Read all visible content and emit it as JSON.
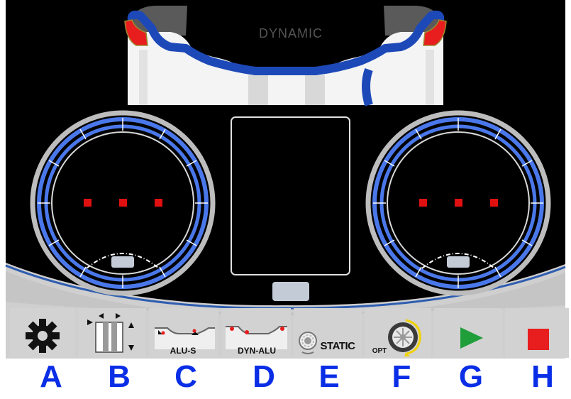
{
  "screen": {
    "mode_title": "DYNAMIC",
    "colors": {
      "panel": "#000000",
      "rim_blue": "#1d49b8",
      "ring_blue": "#4a78ea",
      "plane_marker": "#e01010",
      "weight_red": "#e81e1e",
      "tray_gray": "#c9c9c9",
      "button_gray": "#d2d2d2",
      "letter_blue": "#0a2ee6"
    }
  },
  "left_display": {
    "name": "left-plane-display",
    "readout": "",
    "dots": 3
  },
  "right_display": {
    "name": "right-plane-display",
    "readout": "",
    "dots": 3
  },
  "center_display": {
    "name": "center-value-display",
    "readout": ""
  },
  "function_bar": {
    "buttons": [
      {
        "key": "A",
        "icon": "gear-icon",
        "label": ""
      },
      {
        "key": "B",
        "icon": "arm-position-icon",
        "label": ""
      },
      {
        "key": "C",
        "icon": "alu-s-mode-icon",
        "label": "ALU-S"
      },
      {
        "key": "D",
        "icon": "dyn-alu-mode-icon",
        "label": "DYN-ALU"
      },
      {
        "key": "E",
        "icon": "static-mode-icon",
        "label": "STATIC"
      },
      {
        "key": "F",
        "icon": "optimization-icon",
        "label": "OPT"
      },
      {
        "key": "G",
        "icon": "play-icon",
        "label": ""
      },
      {
        "key": "H",
        "icon": "stop-icon",
        "label": ""
      }
    ]
  }
}
